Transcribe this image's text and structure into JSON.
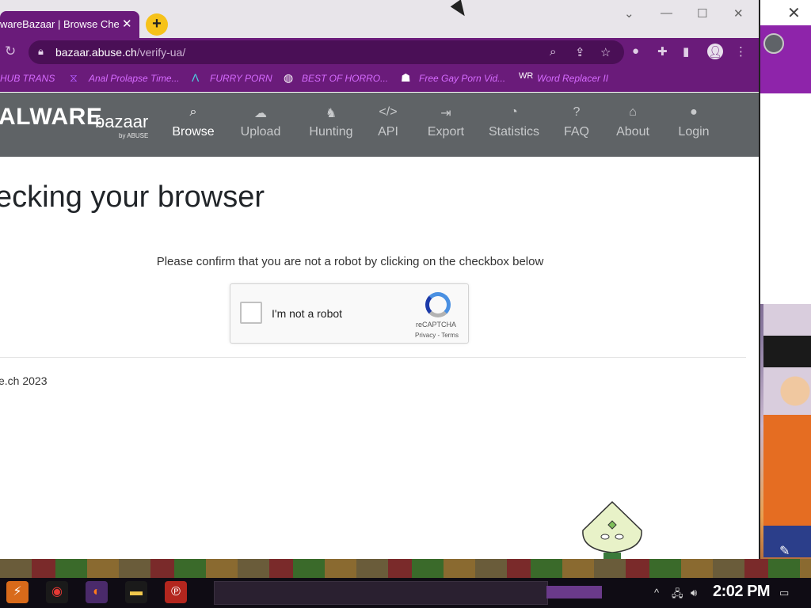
{
  "browser": {
    "tab_title": "wareBazaar | Browse Chec",
    "tab_close": "✕",
    "new_tab": "+",
    "url_host": "bazaar.abuse.ch",
    "url_path": "/verify-ua/",
    "window_controls": {
      "minimize": "—",
      "maximize": "☐",
      "close": "✕",
      "dropdown": "⌄"
    },
    "bookmarks": [
      {
        "label": "HUB TRANS",
        "icon": "bookmark-icon"
      },
      {
        "label": "Anal Prolapse Time...",
        "icon": "bookmark-icon"
      },
      {
        "label": "FURRY PORN",
        "icon": "bookmark-icon"
      },
      {
        "label": "BEST OF HORRO...",
        "icon": "globe-icon"
      },
      {
        "label": "Free Gay Porn Vid...",
        "icon": "bookmark-icon"
      },
      {
        "label": "Word Replacer II",
        "icon": "extension-icon"
      }
    ]
  },
  "site": {
    "brand": "ALWARE",
    "brand_sub": "bazaar",
    "brand_by": "by ABUSE",
    "nav": [
      {
        "label": "Browse",
        "icon": "search-icon",
        "active": true
      },
      {
        "label": "Upload",
        "icon": "cloud-upload-icon"
      },
      {
        "label": "Hunting",
        "icon": "hunting-icon"
      },
      {
        "label": "API",
        "icon": "code-icon"
      },
      {
        "label": "Export",
        "icon": "export-icon"
      },
      {
        "label": "Statistics",
        "icon": "pie-chart-icon"
      },
      {
        "label": "FAQ",
        "icon": "question-icon"
      },
      {
        "label": "About",
        "icon": "archive-icon"
      },
      {
        "label": "Login",
        "icon": "user-icon"
      }
    ]
  },
  "page": {
    "heading": "ecking your browser",
    "confirm_text": "Please confirm that you are not a robot by clicking on the checkbox below",
    "recaptcha": {
      "label": "I'm not a robot",
      "brand": "reCAPTCHA",
      "terms": "Privacy - Terms"
    },
    "footer": "e.ch 2023"
  },
  "taskbar": {
    "clock": "2:02 PM"
  },
  "colors": {
    "accent_purple": "#6a1b7a",
    "nav_gray": "#5f6366",
    "bookmark_text": "#d66bff"
  }
}
